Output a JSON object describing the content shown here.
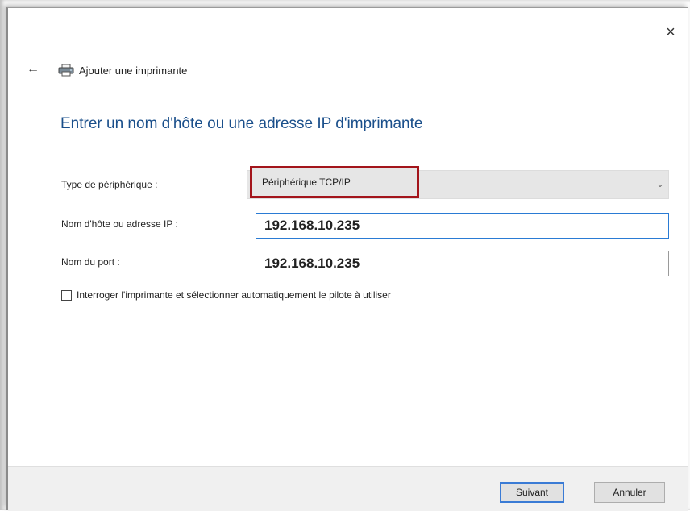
{
  "window": {
    "close_glyph": "×",
    "back_glyph": "←",
    "title": "Ajouter une imprimante",
    "title_icon": "printer-icon"
  },
  "heading": "Entrer un nom d'hôte ou une adresse IP d'imprimante",
  "form": {
    "device_type_label": "Type de périphérique :",
    "device_type_value": "Périphérique TCP/IP",
    "hostname_label": "Nom d'hôte ou adresse IP :",
    "hostname_value": "192.168.10.235",
    "port_label": "Nom du port :",
    "port_value": "192.168.10.235",
    "query_checkbox_label": "Interroger l'imprimante et sélectionner automatiquement le pilote à utiliser",
    "query_checkbox_checked": false
  },
  "buttons": {
    "next": "Suivant",
    "cancel": "Annuler"
  },
  "colors": {
    "heading": "#1a4f8b",
    "highlight_box": "#a3141b",
    "focus_border": "#2a7bd4"
  }
}
